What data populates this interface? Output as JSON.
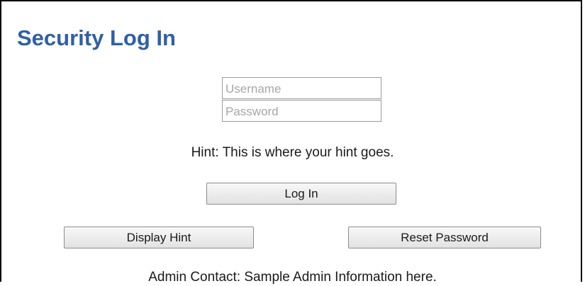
{
  "page": {
    "title": "Security Log In"
  },
  "form": {
    "username": {
      "value": "",
      "placeholder": "Username"
    },
    "password": {
      "value": "",
      "placeholder": "Password"
    }
  },
  "hint": {
    "text": "Hint: This is where your hint goes."
  },
  "buttons": {
    "login_label": "Log In",
    "display_hint_label": "Display Hint",
    "reset_password_label": "Reset Password"
  },
  "admin": {
    "text": "Admin Contact:  Sample Admin Information here."
  },
  "colors": {
    "title": "#2f5fa8",
    "border": "#000000",
    "button_top": "#f8f8f8",
    "button_bottom": "#e2e2e2"
  }
}
